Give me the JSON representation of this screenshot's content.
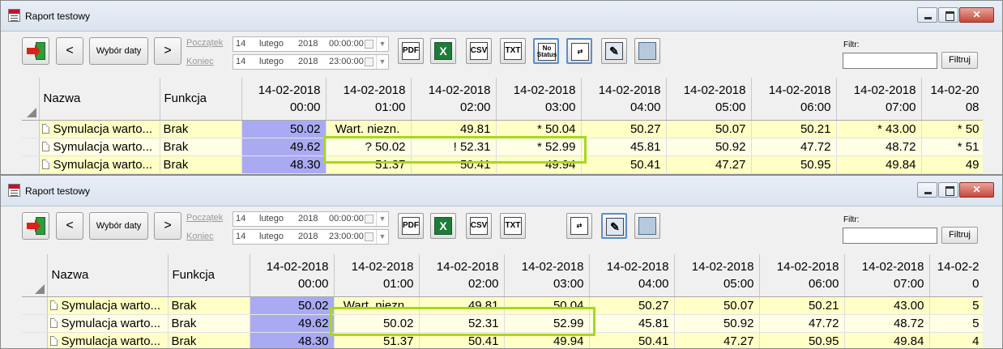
{
  "windows": [
    {
      "title": "Raport testowy",
      "toolbar": {
        "select_date_label": "Wybór daty",
        "start_label": "Początek",
        "end_label": "Koniec",
        "start": {
          "day": "14",
          "month": "lutego",
          "year": "2018",
          "time": "00:00:00"
        },
        "end": {
          "day": "14",
          "month": "lutego",
          "year": "2018",
          "time": "23:00:00"
        },
        "pdf_label": "PDF",
        "excel_label": "X",
        "csv_label": "CSV",
        "txt_label": "TXT",
        "no_status_label": "No Status",
        "filter_label": "Filtr:",
        "filter_value": "",
        "filter_button": "Filtruj"
      },
      "columns": {
        "name": "Nazwa",
        "function": "Funkcja",
        "hours": [
          {
            "date": "14-02-2018",
            "time": "00:00"
          },
          {
            "date": "14-02-2018",
            "time": "01:00"
          },
          {
            "date": "14-02-2018",
            "time": "02:00"
          },
          {
            "date": "14-02-2018",
            "time": "03:00"
          },
          {
            "date": "14-02-2018",
            "time": "04:00"
          },
          {
            "date": "14-02-2018",
            "time": "05:00"
          },
          {
            "date": "14-02-2018",
            "time": "06:00"
          },
          {
            "date": "14-02-2018",
            "time": "07:00"
          },
          {
            "date": "14-02-20",
            "time": "08"
          }
        ]
      },
      "rows": [
        {
          "name": "Symulacja warto...",
          "function": "Brak",
          "values": [
            "50.02",
            "Wart. niezn.",
            "49.81",
            "*  50.04",
            "50.27",
            "50.07",
            "50.21",
            "*  43.00",
            "*  50"
          ]
        },
        {
          "name": "Symulacja warto...",
          "function": "Brak",
          "values": [
            "49.62",
            "?  50.02",
            "!  52.31",
            "*  52.99",
            "45.81",
            "50.92",
            "47.72",
            "48.72",
            "*  51"
          ]
        },
        {
          "name": "Symulacja warto...",
          "function": "Brak",
          "values": [
            "48.30",
            "51.37",
            "50.41",
            "49.94",
            "50.41",
            "47.27",
            "50.95",
            "49.84",
            "49"
          ]
        }
      ]
    },
    {
      "title": "Raport testowy",
      "toolbar": {
        "select_date_label": "Wybór daty",
        "start_label": "Początek",
        "end_label": "Koniec",
        "start": {
          "day": "14",
          "month": "lutego",
          "year": "2018",
          "time": "00:00:00"
        },
        "end": {
          "day": "14",
          "month": "lutego",
          "year": "2018",
          "time": "23:00:00"
        },
        "pdf_label": "PDF",
        "excel_label": "X",
        "csv_label": "CSV",
        "txt_label": "TXT",
        "filter_label": "Filtr:",
        "filter_value": "",
        "filter_button": "Filtruj"
      },
      "columns": {
        "name": "Nazwa",
        "function": "Funkcja",
        "hours": [
          {
            "date": "14-02-2018",
            "time": "00:00"
          },
          {
            "date": "14-02-2018",
            "time": "01:00"
          },
          {
            "date": "14-02-2018",
            "time": "02:00"
          },
          {
            "date": "14-02-2018",
            "time": "03:00"
          },
          {
            "date": "14-02-2018",
            "time": "04:00"
          },
          {
            "date": "14-02-2018",
            "time": "05:00"
          },
          {
            "date": "14-02-2018",
            "time": "06:00"
          },
          {
            "date": "14-02-2018",
            "time": "07:00"
          },
          {
            "date": "14-02-2",
            "time": "0"
          }
        ]
      },
      "rows": [
        {
          "name": "Symulacja warto...",
          "function": "Brak",
          "values": [
            "50.02",
            "Wart. niezn.",
            "49.81",
            "50.04",
            "50.27",
            "50.07",
            "50.21",
            "43.00",
            "5"
          ]
        },
        {
          "name": "Symulacja warto...",
          "function": "Brak",
          "values": [
            "49.62",
            "50.02",
            "52.31",
            "52.99",
            "45.81",
            "50.92",
            "47.72",
            "48.72",
            "5"
          ]
        },
        {
          "name": "Symulacja warto...",
          "function": "Brak",
          "values": [
            "48.30",
            "51.37",
            "50.41",
            "49.94",
            "50.41",
            "47.27",
            "50.95",
            "49.84",
            "4"
          ]
        }
      ]
    }
  ],
  "colors": {
    "row_yellow": "#ffffc6",
    "selected_cell": "#aaaaf2",
    "highlight_frame": "#a8d81a"
  },
  "icons": [
    "exit-icon",
    "chevron-left-icon",
    "chevron-right-icon",
    "pdf-icon",
    "excel-icon",
    "csv-icon",
    "txt-icon",
    "no-status-icon",
    "table-format-icon",
    "signature-icon",
    "print-icon",
    "calendar-checkbox-icon"
  ]
}
